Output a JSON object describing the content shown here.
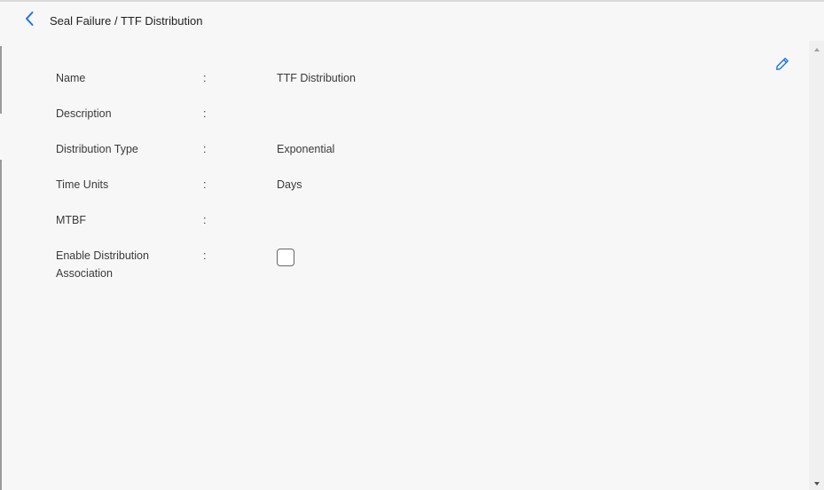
{
  "header": {
    "title": "Seal Failure / TTF Distribution",
    "back_icon": "chevron-left-icon"
  },
  "toolbar": {
    "edit_icon": "pencil-icon"
  },
  "fields": [
    {
      "label": "Name",
      "colon": ":",
      "value": "TTF Distribution"
    },
    {
      "label": "Description",
      "colon": ":",
      "value": ""
    },
    {
      "label": "Distribution Type",
      "colon": ":",
      "value": "Exponential"
    },
    {
      "label": "Time Units",
      "colon": ":",
      "value": "Days"
    },
    {
      "label": "MTBF",
      "colon": ":",
      "value": ""
    },
    {
      "label": "Enable Distribution Association",
      "colon": ":",
      "checked": false
    }
  ],
  "colors": {
    "accent": "#1a73e8",
    "background": "#f7f7f7",
    "text": "#333333"
  }
}
